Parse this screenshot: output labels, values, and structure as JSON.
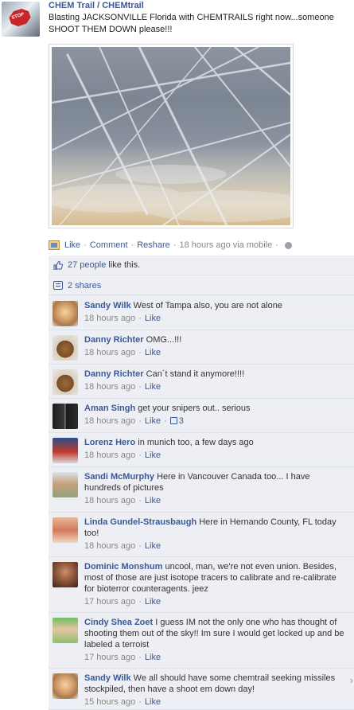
{
  "post": {
    "author": "CHEM Trail / CHEMtrail",
    "avatar_icon": "stop-sign-icon",
    "avatar_text": "STOP",
    "text": "Blasting JACKSONVILLE Florida with CHEMTRAILS right now...someone SHOOT THEM DOWN please!!!",
    "actions": {
      "like": "Like",
      "comment": "Comment",
      "reshare": "Reshare",
      "separator": "·",
      "time": "18 hours ago via mobile",
      "trailing_separator": "·"
    },
    "likes": {
      "people": "27 people",
      "suffix": " like this."
    },
    "shares": "2 shares"
  },
  "comments": [
    {
      "name": "Sandy Wilk",
      "text": "West of Tampa also, you are not alone",
      "time": "18 hours ago",
      "like": "Like",
      "avatar": "cat"
    },
    {
      "name": "Danny Richter",
      "text": "OMG...!!!",
      "time": "18 hours ago",
      "like": "Like",
      "avatar": "bear"
    },
    {
      "name": "Danny Richter",
      "text": "Can´t stand it anymore!!!!",
      "time": "18 hours ago",
      "like": "Like",
      "avatar": "bear"
    },
    {
      "name": "Aman Singh",
      "text": "get your snipers out.. serious",
      "time": "18 hours ago",
      "like": "Like",
      "like_count": "3",
      "avatar": "group"
    },
    {
      "name": "Lorenz Hero",
      "text": "in munich too, a few days ago",
      "time": "18 hours ago",
      "like": "Like",
      "avatar": "lorenz"
    },
    {
      "name": "Sandi McMurphy",
      "text": "Here in Vancouver Canada too... I have hundreds of pictures",
      "time": "18 hours ago",
      "like": "Like",
      "avatar": "sandi"
    },
    {
      "name": "Linda Gundel-Strausbaugh",
      "text": "Here in Hernando County, FL today too!",
      "time": "18 hours ago",
      "like": "Like",
      "avatar": "linda"
    },
    {
      "name": "Dominic Monshum",
      "text": "uncool, man, we're not even union. Besides, most of those are just isotope tracers to calibrate and re-calibrate for bioterror counteragents. jeez",
      "time": "17 hours ago",
      "like": "Like",
      "avatar": "dominic"
    },
    {
      "name": "Cindy Shea Zoet",
      "text": "I guess IM not the only one who has thought of shooting them out of the sky!! Im sure I would get locked up and be labeled a terroist",
      "time": "17 hours ago",
      "like": "Like",
      "avatar": "cindy"
    },
    {
      "name": "Sandy Wilk",
      "text": "We all should have some chemtrail seeking missiles stockpiled, then have a shoot em down day!",
      "time": "15 hours ago",
      "like": "Like",
      "avatar": "cat"
    }
  ],
  "scroll_arrow": "›"
}
